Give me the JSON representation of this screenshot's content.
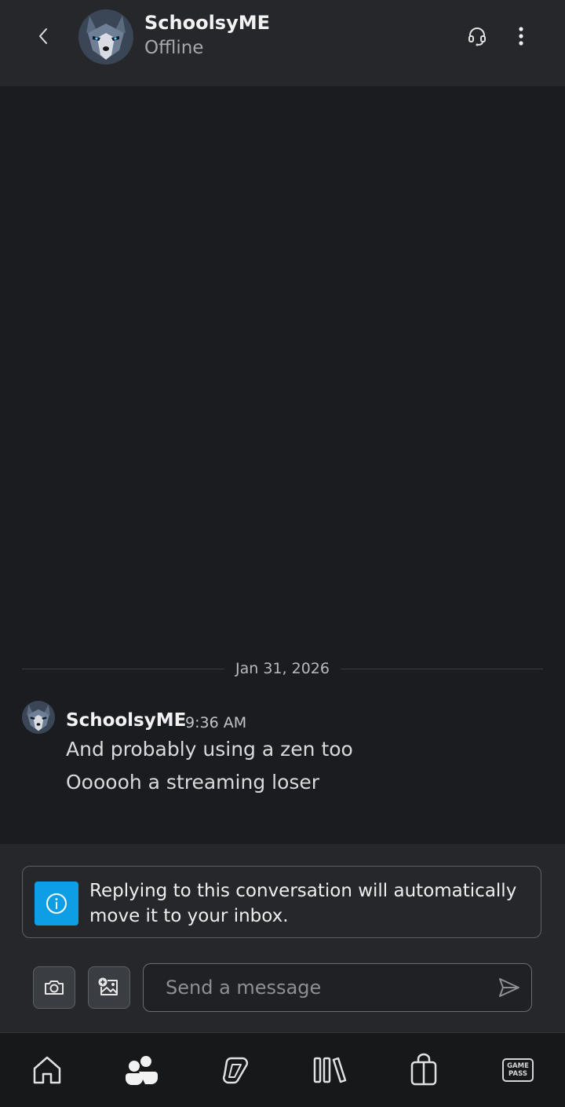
{
  "header": {
    "contact_name": "SchoolsyME",
    "status": "Offline",
    "back_icon": "chevron-left-icon",
    "headset_icon": "headset-icon",
    "more_icon": "more-vertical-icon"
  },
  "chat": {
    "date_divider": "Jan 31, 2026",
    "messages": [
      {
        "sender": "SchoolsyME",
        "time": "9:36 AM",
        "lines": [
          "And probably using a zen too",
          "Oooooh a streaming loser"
        ]
      }
    ]
  },
  "compose": {
    "info_banner": "Replying to this conversation will automatically move it to your inbox.",
    "input_placeholder": "Send a message",
    "input_value": "",
    "accent_color": "#0e9ee6"
  },
  "nav": {
    "items": [
      {
        "name": "home",
        "icon": "home-icon",
        "active": false
      },
      {
        "name": "social",
        "icon": "people-icon",
        "active": true
      },
      {
        "name": "copilot",
        "icon": "copilot-icon",
        "active": false
      },
      {
        "name": "library",
        "icon": "library-icon",
        "active": false
      },
      {
        "name": "store",
        "icon": "store-bag-icon",
        "active": false
      },
      {
        "name": "game-pass",
        "icon": "game-pass-icon",
        "active": false,
        "badge_line1": "GAME",
        "badge_line2": "PASS"
      }
    ]
  }
}
